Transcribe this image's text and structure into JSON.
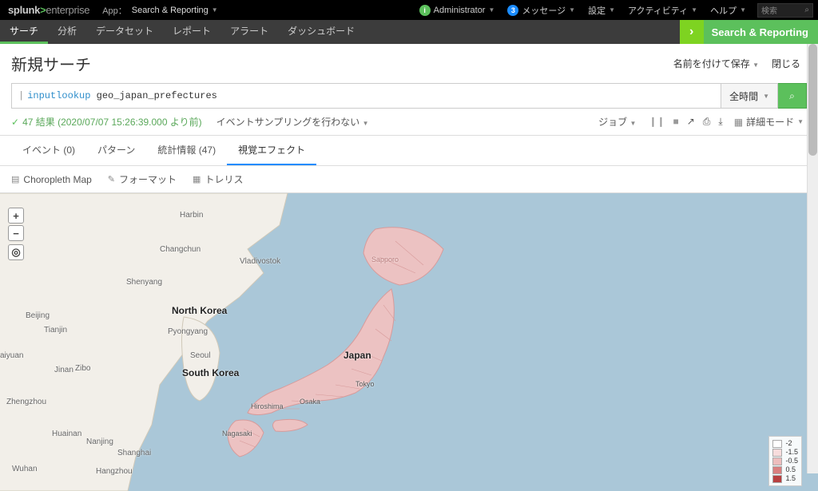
{
  "logo": {
    "brand": "splunk",
    "gt": ">",
    "product": "enterprise"
  },
  "appLabel": "App：",
  "appName": "Search & Reporting",
  "topmenu": {
    "admin": "Administrator",
    "messages": "メッセージ",
    "messagesCount": "3",
    "settings": "設定",
    "activity": "アクティビティ",
    "help": "ヘルプ",
    "searchPlaceholder": "検索"
  },
  "nav2": {
    "search": "サーチ",
    "analysis": "分析",
    "dataset": "データセット",
    "report": "レポート",
    "alert": "アラート",
    "dashboard": "ダッシュボード"
  },
  "srBadge": "Search & Reporting",
  "title": "新規サーチ",
  "titleActions": {
    "saveAs": "名前を付けて保存",
    "close": "閉じる"
  },
  "search": {
    "pipe": "|",
    "cmd": "inputlookup",
    "arg": "geo_japan_prefectures",
    "timeRange": "全時間"
  },
  "status": {
    "text": "47 結果 (2020/07/07 15:26:39.000 より前)",
    "sampling": "イベントサンプリングを行わない"
  },
  "jobmenu": {
    "job": "ジョブ",
    "mode": "詳細モード"
  },
  "tabs": {
    "events": "イベント (0)",
    "patterns": "パターン",
    "stats": "統計情報 (47)",
    "viz": "視覚エフェクト"
  },
  "viztools": {
    "choropleth": "Choropleth Map",
    "format": "フォーマット",
    "trellis": "トレリス"
  },
  "mapLabels": {
    "harbin": "Harbin",
    "changchun": "Changchun",
    "vladivostok": "Vladivostok",
    "shenyang": "Shenyang",
    "beijing": "Beijing",
    "tianjin": "Tianjin",
    "pyongyang": "Pyongyang",
    "seoul": "Seoul",
    "jinan": "Jinan",
    "zibo": "Zibo",
    "zhengzhou": "Zhengzhou",
    "huainan": "Huainan",
    "nanjing": "Nanjing",
    "shanghai": "Shanghai",
    "wuhan": "Wuhan",
    "hangzhou": "Hangzhou",
    "taiyuan": "aiyuan",
    "northKorea": "North Korea",
    "southKorea": "South Korea",
    "sapporo": "Sapporo",
    "japan": "Japan",
    "tokyo": "Tokyo",
    "osaka": "Osaka",
    "hiroshima": "Hiroshima",
    "nagasaki": "Nagasaki"
  },
  "legend": [
    {
      "color": "#ffffff",
      "label": "-2"
    },
    {
      "color": "#f7dcdc",
      "label": "-1.5"
    },
    {
      "color": "#edbdbd",
      "label": "-0.5"
    },
    {
      "color": "#d97f7f",
      "label": "0.5"
    },
    {
      "color": "#b84040",
      "label": "1.5"
    }
  ]
}
